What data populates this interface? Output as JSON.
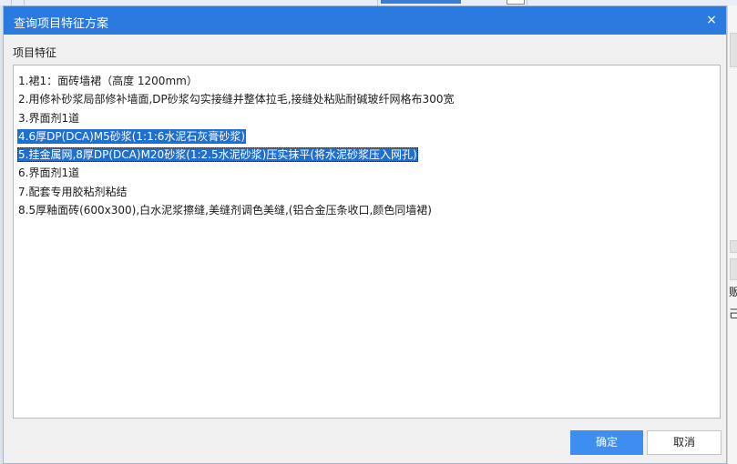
{
  "dialog": {
    "title": "查询项目特征方案",
    "close_glyph": "×",
    "section_label": "项目特征",
    "lines": [
      {
        "text": "1.裙1：面砖墙裙（高度 1200mm）",
        "selected": false
      },
      {
        "text": "2.用修补砂浆局部修补墙面,DP砂浆勾实接缝并整体拉毛,接缝处粘贴耐碱玻纤网格布300宽",
        "selected": false
      },
      {
        "text": "3.界面剂1道",
        "selected": false
      },
      {
        "text": "4.6厚DP(DCA)M5砂浆(1:1:6水泥石灰膏砂浆)",
        "selected": true
      },
      {
        "text": "5.挂金属网,8厚DP(DCA)M20砂浆(1:2.5水泥砂浆)压实抹平(将水泥砂浆压入网孔)",
        "selected": true
      },
      {
        "text": "6.界面剂1道",
        "selected": false
      },
      {
        "text": "7.配套专用胶粘剂粘结",
        "selected": false
      },
      {
        "text": "8.5厚釉面砖(600x300),白水泥浆擦缝,美缝剂调色美缝,(铝合金压条收口,颜色同墙裙)",
        "selected": false
      }
    ],
    "ok_label": "确定",
    "cancel_label": "取消"
  },
  "background": {
    "right_glyphs": [
      "贩",
      "己"
    ]
  },
  "colors": {
    "titlebar": "#2b7ae0",
    "selection": "#1e6fd0",
    "primary_button": "#3d8ef0"
  }
}
